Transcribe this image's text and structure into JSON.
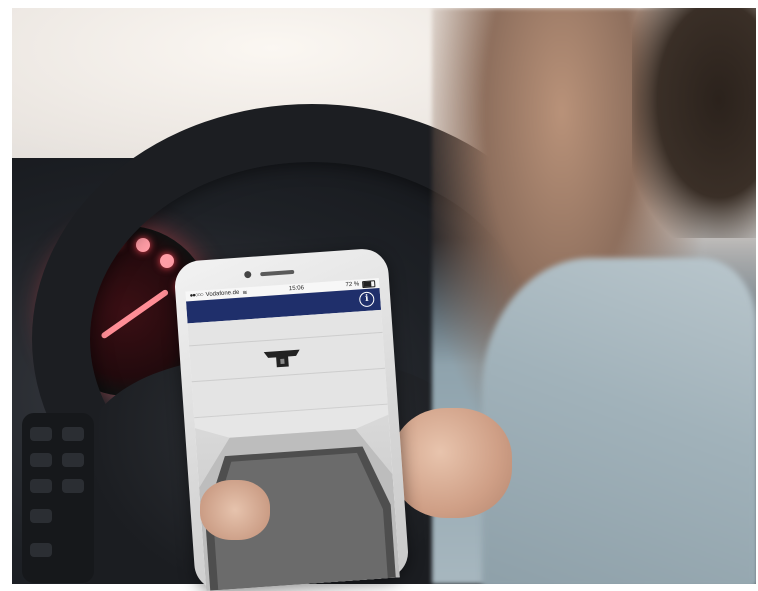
{
  "scene": {
    "description_icons": [
      "steering-wheel",
      "speedometer",
      "smartphone",
      "person"
    ]
  },
  "phone_screen": {
    "status": {
      "carrier": "Vodafone.de",
      "time": "15:06",
      "battery": "72 %",
      "battery_level": 0.72
    },
    "header": {
      "bg_color": "#1f2f6b",
      "info_icon": "info-icon",
      "info_glyph": "i"
    },
    "panel": {
      "icon": "key-fob-icon"
    }
  },
  "colors": {
    "gauge_glow": "#ff4a5a",
    "header_blue": "#1f2f6b"
  }
}
